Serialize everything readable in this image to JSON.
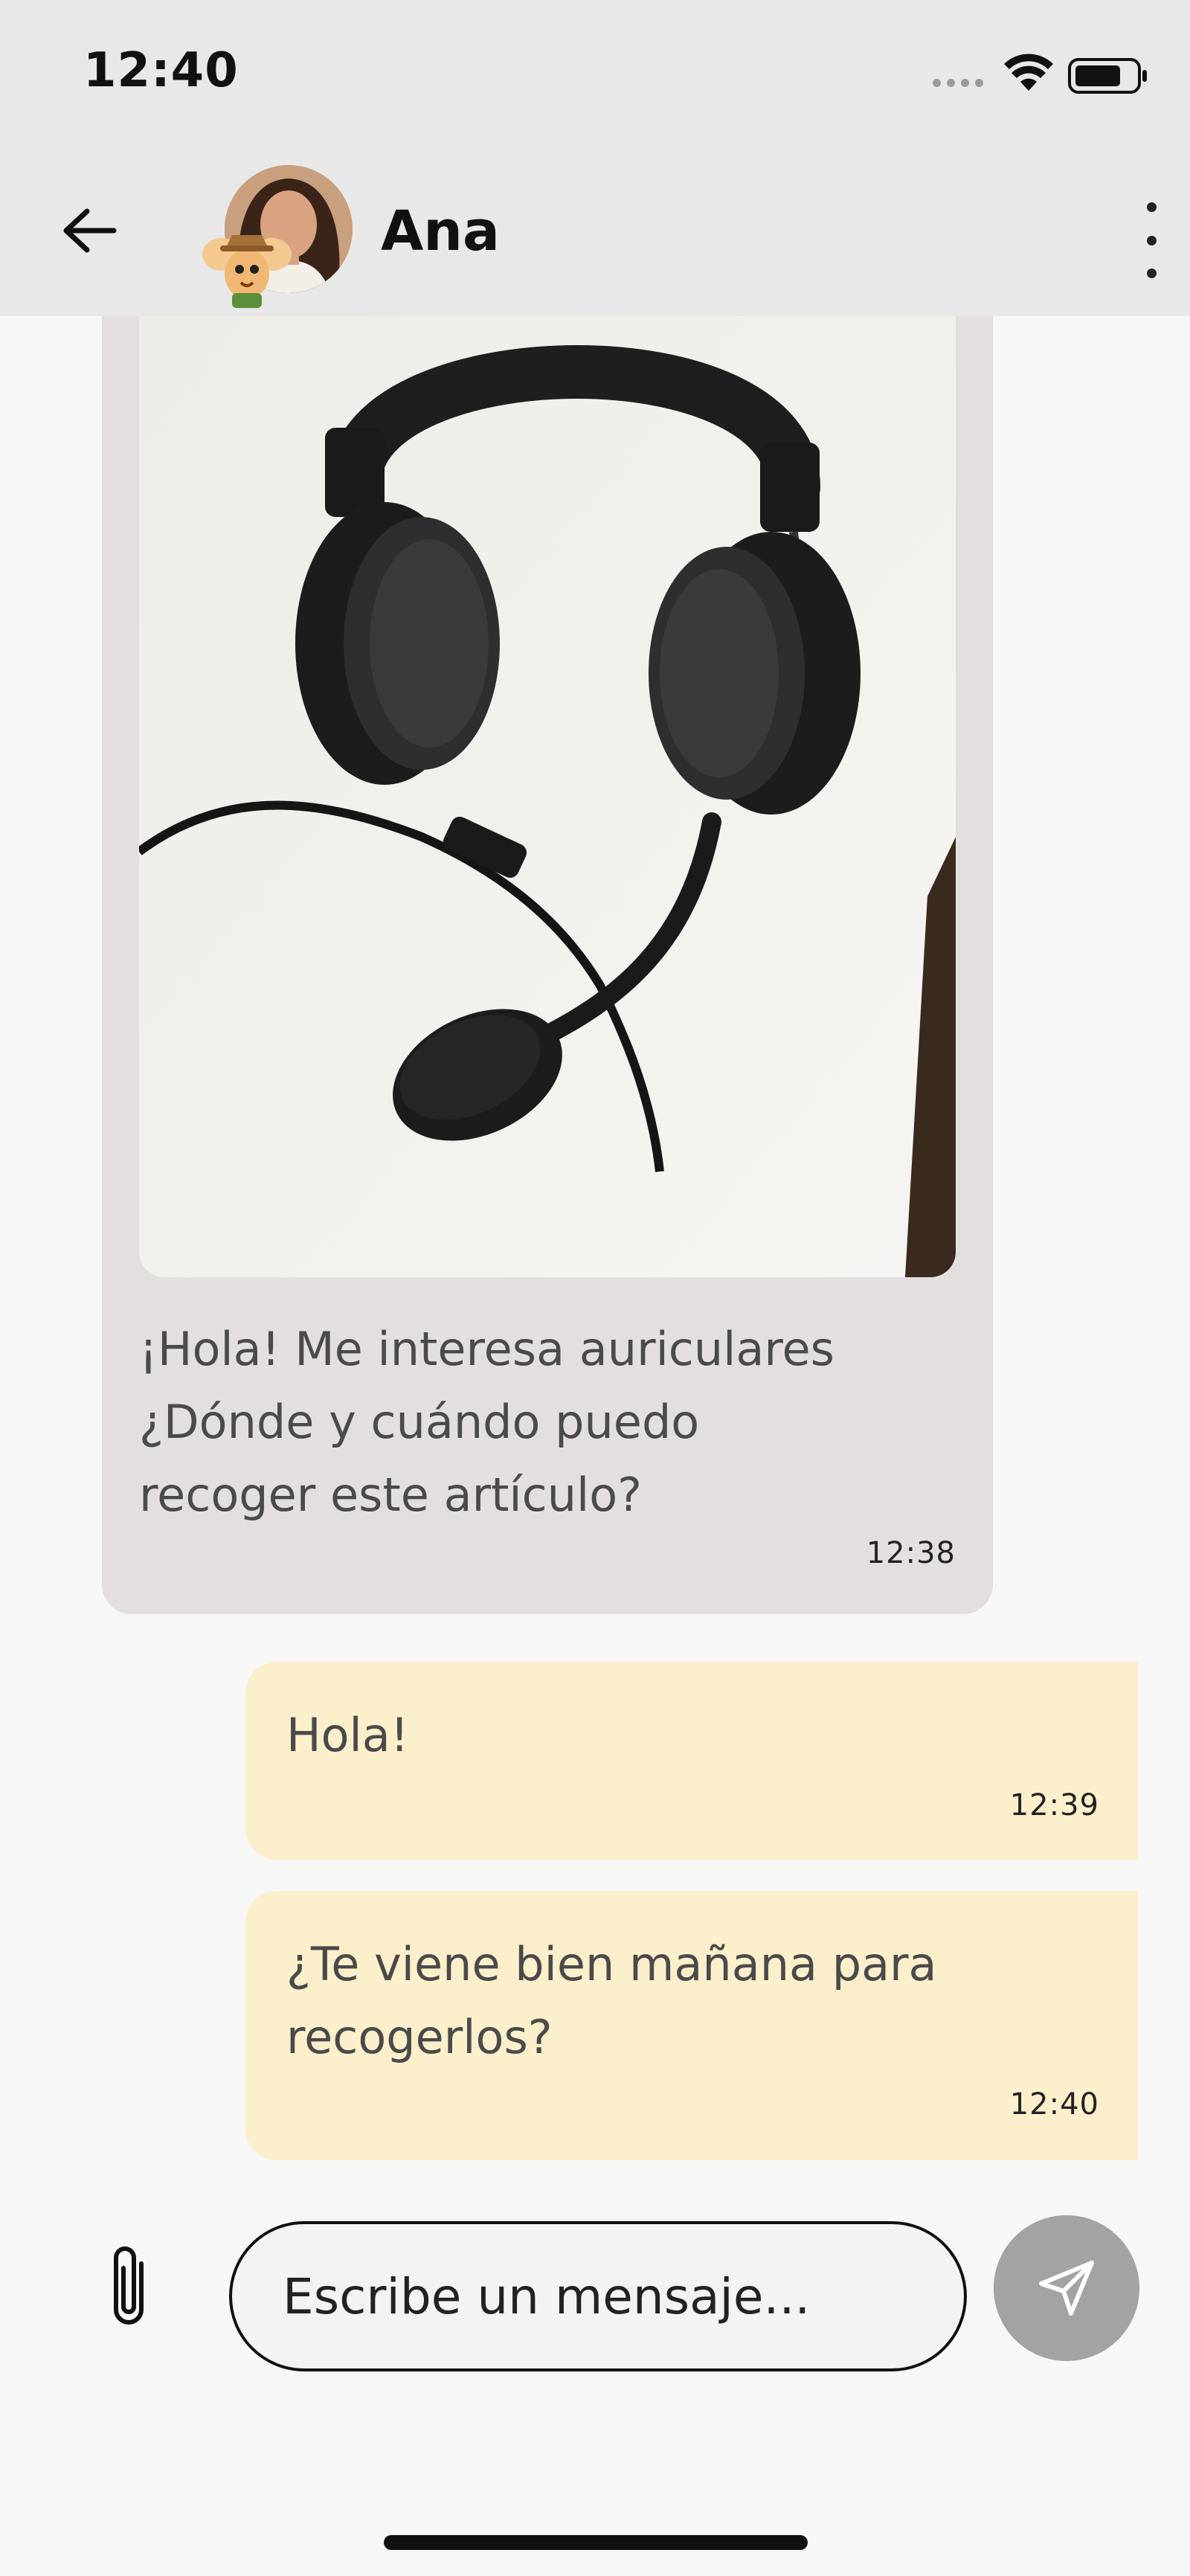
{
  "status_bar": {
    "time": "12:40"
  },
  "header": {
    "contact_name": "Ana"
  },
  "messages": [
    {
      "direction": "incoming",
      "image": "headphones-photo",
      "text": "¡Hola! Me interesa auriculares\n    ¿Dónde y cuándo puedo\nrecoger este artículo?",
      "time": "12:38"
    },
    {
      "direction": "outgoing",
      "text": "Hola!",
      "time": "12:39"
    },
    {
      "direction": "outgoing",
      "text": "¿Te viene bien mañana para recogerlos?",
      "time": "12:40"
    }
  ],
  "composer": {
    "placeholder": "Escribe un mensaje..."
  },
  "colors": {
    "header_bg": "#e8e8e8",
    "incoming_bubble": "#e4dfdf",
    "outgoing_bubble": "#fcefcb",
    "send_button": "#a3a3a3"
  },
  "icons": [
    "back-arrow-icon",
    "more-vert-icon",
    "paperclip-icon",
    "send-icon",
    "wifi-icon",
    "battery-icon",
    "signal-icon"
  ]
}
